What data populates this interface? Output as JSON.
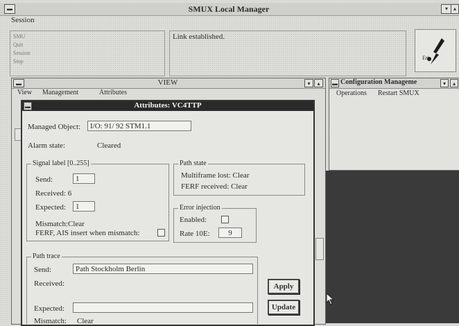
{
  "main": {
    "title": "SMUX Local Manager",
    "menu_session": "Session",
    "list_items": [
      "SMU",
      "Quit",
      "Session",
      "Stop"
    ],
    "status_text": "Link established.",
    "logo_caption": "Eri"
  },
  "view": {
    "title": "VIEW",
    "menu": [
      "View",
      "Management",
      "Attributes"
    ]
  },
  "config": {
    "title": "Configuration Manageme",
    "menu": [
      "Operations",
      "Restart SMUX"
    ]
  },
  "attr": {
    "title": "Attributes: VC4TTP",
    "managed_object_label": "Managed Object:",
    "managed_object_value": "I/O: 91/ 92 STM1.1",
    "alarm_state_label": "Alarm state:",
    "alarm_state_value": "Cleared",
    "signal_group": "Signal label [0..255]",
    "send_label": "Send:",
    "send_value": "1",
    "received_label": "Received: 6",
    "expected_label": "Expected:",
    "expected_value": "1",
    "mismatch_text": "Mismatch:Clear",
    "ferf_ais_text": "FERF, AIS insert when mismatch:",
    "path_state_group": "Path state",
    "multiframe_text": "Multiframe lost: Clear",
    "ferf_received_text": "FERF received: Clear",
    "error_group": "Error injection",
    "enabled_label": "Enabled:",
    "rate_label": "Rate 10E:",
    "rate_value": "9",
    "path_trace_group": "Path trace",
    "pt_send_label": "Send:",
    "pt_send_value": "Path Stockholm Berlin",
    "pt_received_label": "Received:",
    "pt_expected_label": "Expected:",
    "pt_mismatch_label": "Mismatch:",
    "pt_mismatch_value": "Clear",
    "apply_label": "Apply",
    "update_label": "Update"
  }
}
